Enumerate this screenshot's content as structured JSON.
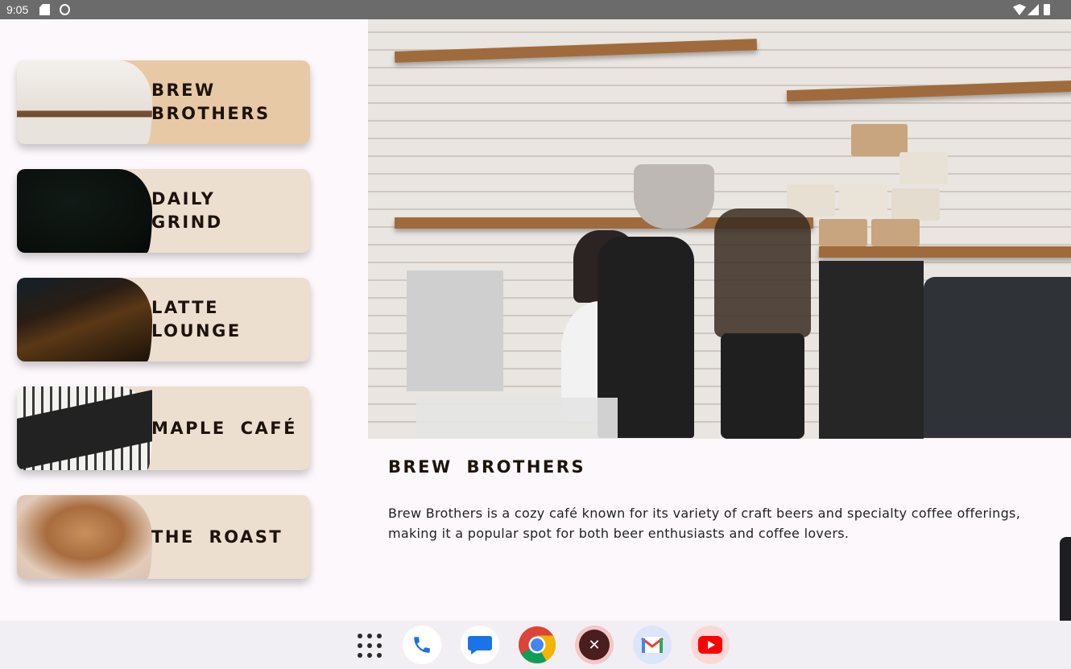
{
  "status_bar": {
    "time": "9:05",
    "icons": [
      "sd-card-icon",
      "face-icon",
      "wifi-icon",
      "signal-icon",
      "battery-icon"
    ]
  },
  "cafes": [
    {
      "name": "Brew\nBrothers",
      "selected": true,
      "thumb": "thumb-brew"
    },
    {
      "name": "Daily\nGrind",
      "selected": false,
      "thumb": "thumb-daily"
    },
    {
      "name": "Latte\nLounge",
      "selected": false,
      "thumb": "thumb-latte"
    },
    {
      "name": "Maple Café",
      "selected": false,
      "thumb": "thumb-maple"
    },
    {
      "name": "The Roast",
      "selected": false,
      "thumb": "thumb-roast"
    }
  ],
  "detail": {
    "title": "Brew Brothers",
    "description": "Brew Brothers is a cozy café known for its variety of craft beers and specialty coffee offerings, making it a popular spot for both beer enthusiasts and coffee lovers."
  },
  "taskbar": {
    "apps": [
      "all-apps-icon",
      "phone-app-icon",
      "messages-app-icon",
      "chrome-app-icon",
      "restaurant-app-icon",
      "gmail-app-icon",
      "youtube-app-icon"
    ]
  },
  "colors": {
    "card_bg": "#ecdfd0",
    "card_selected_bg": "#e8c9a6",
    "title_text": "#1d130c",
    "page_bg": "#fdf8fc"
  }
}
